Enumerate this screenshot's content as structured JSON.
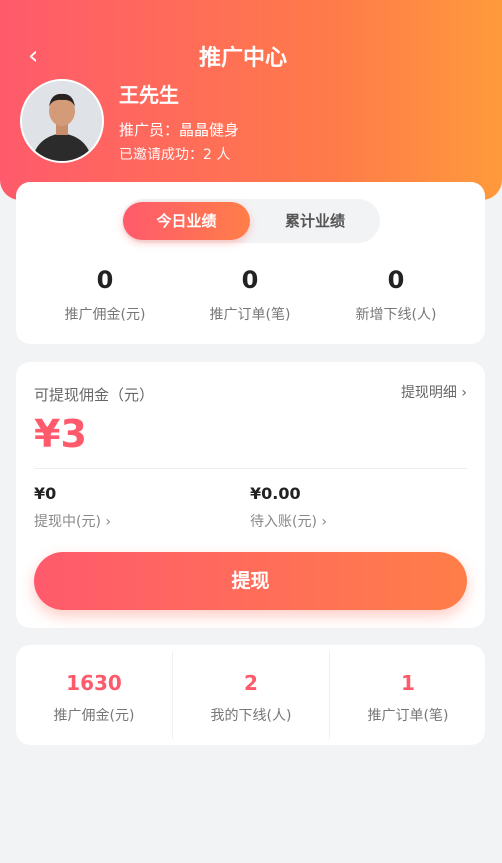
{
  "header": {
    "back_icon": "‹",
    "title": "推广中心",
    "user_name": "王先生",
    "promoter": "推广员：晶晶健身",
    "invited": "已邀请成功：2 人"
  },
  "performance": {
    "tabs": [
      "今日业绩",
      "累计业绩"
    ],
    "active_tab": 0,
    "stats": [
      {
        "value": "0",
        "label": "推广佣金(元)"
      },
      {
        "value": "0",
        "label": "推广订单(笔)"
      },
      {
        "value": "0",
        "label": "新增下线(人)"
      }
    ]
  },
  "commission": {
    "available_label": "可提现佣金（元）",
    "detail_link": "提现明细 ›",
    "amount": "¥3",
    "withdrawing_value": "¥0",
    "withdrawing_label": "提现中(元) ›",
    "pending_value": "¥0.00",
    "pending_label": "待入账(元) ›",
    "withdraw_button": "提现"
  },
  "summary": [
    {
      "value": "1630",
      "label": "推广佣金(元)"
    },
    {
      "value": "2",
      "label": "我的下线(人)"
    },
    {
      "value": "1",
      "label": "推广订单(笔)"
    }
  ],
  "colors": {
    "accent": "#ff5a6c",
    "gradient_end": "#ff9a3c"
  }
}
